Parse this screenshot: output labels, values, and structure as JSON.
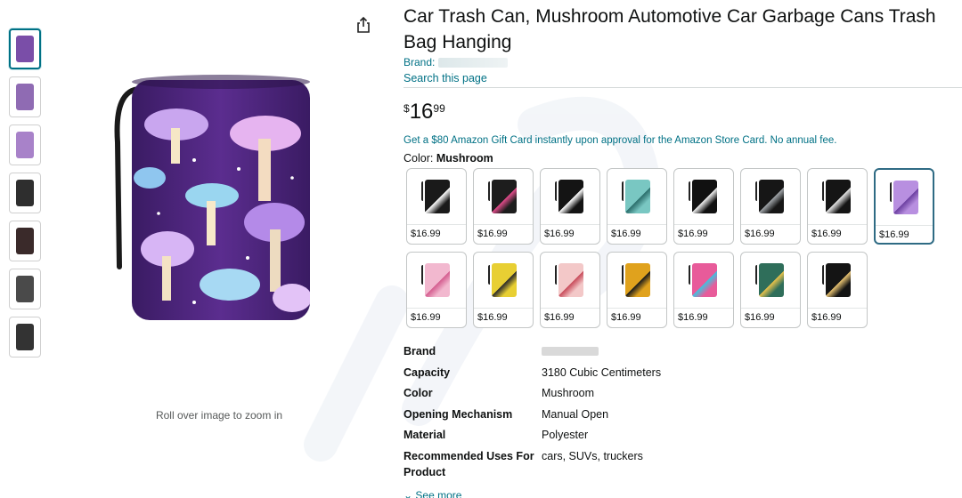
{
  "product": {
    "title": "Car Trash Can, Mushroom Automotive Car Garbage Cans Trash Bag Hanging",
    "brand_label": "Brand:",
    "search_link": "Search this page",
    "price_symbol": "$",
    "price_whole": "16",
    "price_fraction": "99",
    "promo_text": "Get a $80 Amazon Gift Card instantly upon approval for the Amazon Store Card. No annual fee.",
    "color_label": "Color:",
    "color_value": "Mushroom",
    "zoom_hint": "Roll over image to zoom in",
    "see_more": "See more"
  },
  "thumbnails": [
    {
      "name": "thumb-mushroom-purple",
      "color": "#7a4ea8"
    },
    {
      "name": "thumb-set",
      "color": "#8f6bb3"
    },
    {
      "name": "thumb-dimensions",
      "color": "#a882c9"
    },
    {
      "name": "thumb-car-interior",
      "color": "#2e2e2e"
    },
    {
      "name": "thumb-hanging-seat",
      "color": "#3a2a2a"
    },
    {
      "name": "thumb-accessories",
      "color": "#4a4a4a"
    },
    {
      "name": "thumb-dashboard",
      "color": "#333333"
    }
  ],
  "swatches": [
    {
      "price": "$16.99",
      "color": "#1a1a1a",
      "accent": "#ffffff"
    },
    {
      "price": "$16.99",
      "color": "#1d1d1d",
      "accent": "#e04b8a"
    },
    {
      "price": "$16.99",
      "color": "#141414",
      "accent": "#ffffff"
    },
    {
      "price": "$16.99",
      "color": "#79c7c2",
      "accent": "#2a6d6b"
    },
    {
      "price": "$16.99",
      "color": "#111111",
      "accent": "#f0f0f0"
    },
    {
      "price": "$16.99",
      "color": "#161616",
      "accent": "#9fa4a8"
    },
    {
      "price": "$16.99",
      "color": "#151515",
      "accent": "#e6e6e6"
    },
    {
      "price": "$16.99",
      "color": "#b88fe0",
      "accent": "#6b3fa0"
    },
    {
      "price": "$16.99",
      "color": "#f2b8cf",
      "accent": "#d45d8f"
    },
    {
      "price": "$16.99",
      "color": "#e8cf33",
      "accent": "#2a2a2a"
    },
    {
      "price": "$16.99",
      "color": "#f3c8c8",
      "accent": "#c84b5a"
    },
    {
      "price": "$16.99",
      "color": "#e0a21d",
      "accent": "#1a1a1a"
    },
    {
      "price": "$16.99",
      "color": "#e85b9a",
      "accent": "#3ec2e0"
    },
    {
      "price": "$16.99",
      "color": "#2f6e5a",
      "accent": "#e8c24a"
    },
    {
      "price": "$16.99",
      "color": "#141414",
      "accent": "#e6c170"
    }
  ],
  "specs": [
    {
      "key": "Brand",
      "value": ""
    },
    {
      "key": "Capacity",
      "value": "3180 Cubic Centimeters"
    },
    {
      "key": "Color",
      "value": "Mushroom"
    },
    {
      "key": "Opening Mechanism",
      "value": "Manual Open"
    },
    {
      "key": "Material",
      "value": "Polyester"
    },
    {
      "key": "Recommended Uses For Product",
      "value": "cars, SUVs, truckers"
    }
  ],
  "colors": {
    "link": "#007185",
    "selected_border": "#2f6b84",
    "text": "#0f1111"
  },
  "icons": {
    "share": "share-icon",
    "chevron": "chevron-down-icon"
  }
}
